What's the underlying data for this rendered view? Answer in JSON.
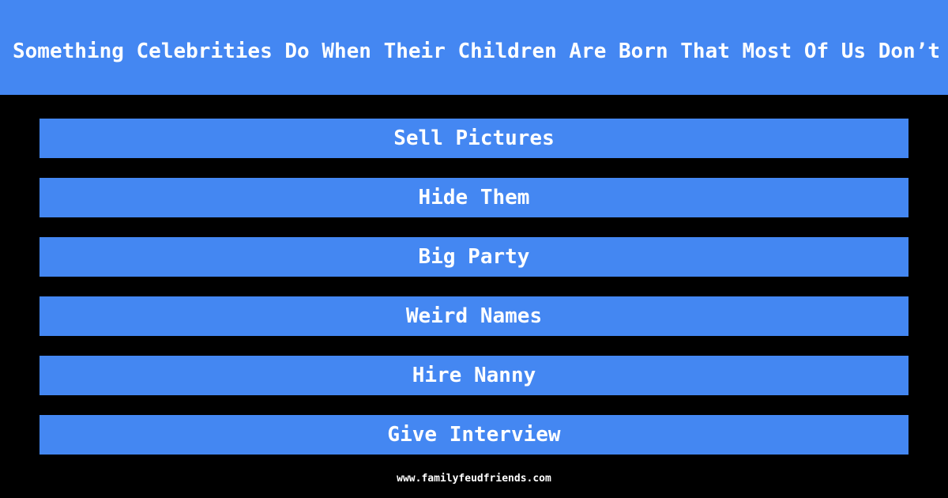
{
  "header": {
    "title": "Something Celebrities Do When Their Children Are Born That Most Of Us Don’t"
  },
  "answers": [
    {
      "label": "Sell Pictures"
    },
    {
      "label": "Hide Them"
    },
    {
      "label": "Big Party"
    },
    {
      "label": "Weird Names"
    },
    {
      "label": "Hire Nanny"
    },
    {
      "label": "Give Interview"
    }
  ],
  "footer": {
    "url": "www.familyfeudfriends.com"
  },
  "colors": {
    "accent": "#4487f2",
    "background": "#000000",
    "text": "#ffffff"
  }
}
